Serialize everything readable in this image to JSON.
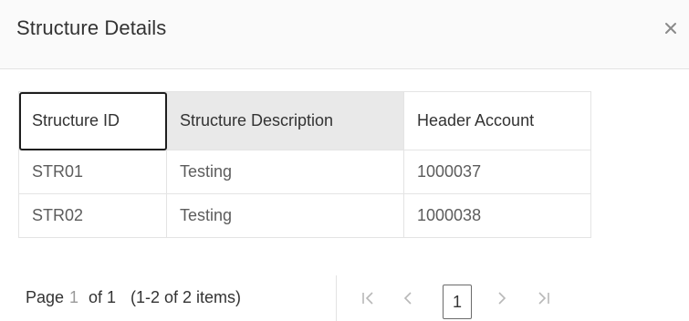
{
  "dialog": {
    "title": "Structure Details",
    "close_icon": "close-icon"
  },
  "table": {
    "columns": [
      "Structure ID",
      "Structure Description",
      "Header Account"
    ],
    "rows": [
      [
        "STR01",
        "Testing",
        "1000037"
      ],
      [
        "STR02",
        "Testing",
        "1000038"
      ]
    ]
  },
  "pager": {
    "page_label": "Page",
    "current_page": "1",
    "of_text": "of 1",
    "range_text": "(1-2 of 2 items)",
    "first_icon": "first-page-icon",
    "prev_icon": "previous-page-icon",
    "next_icon": "next-page-icon",
    "last_icon": "last-page-icon",
    "page_button": "1"
  }
}
